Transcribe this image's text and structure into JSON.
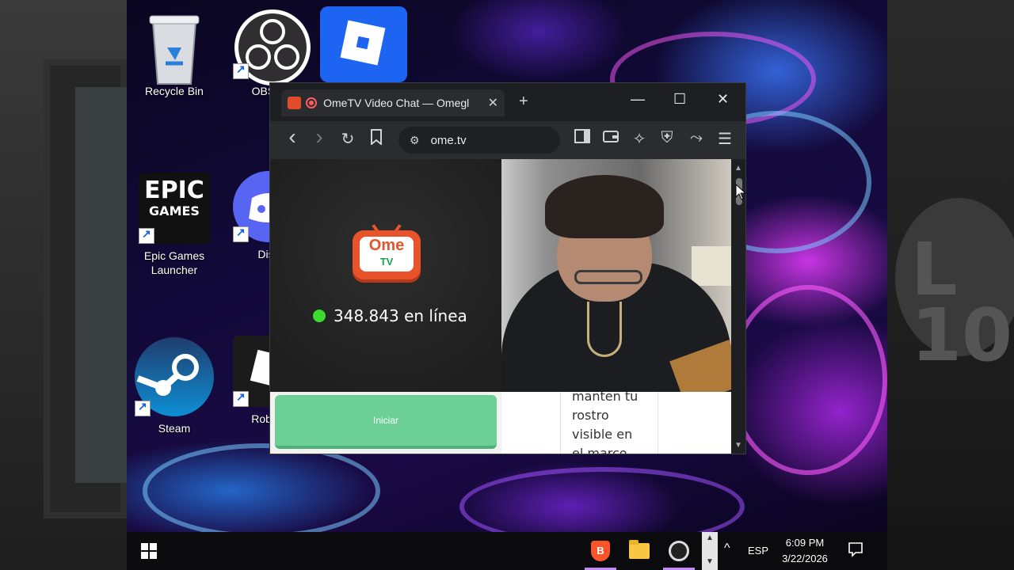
{
  "desktop": {
    "icons": [
      {
        "name": "recycle-bin",
        "label": "Recycle Bin"
      },
      {
        "name": "obs-studio",
        "label": "OBS S"
      },
      {
        "name": "roblox-studio",
        "label": ""
      },
      {
        "name": "epic-games",
        "label": "Epic Games\nLauncher",
        "badge": "EPIC\nGAMES"
      },
      {
        "name": "discord",
        "label": "Disc"
      },
      {
        "name": "steam",
        "label": "Steam"
      },
      {
        "name": "roblox",
        "label": "Roblox"
      }
    ],
    "watermark": "L\n10"
  },
  "browser": {
    "tab_title": "OmeTV Video Chat — Omegl",
    "tab_close": "✕",
    "new_tab": "+",
    "window_controls": {
      "minimize": "—",
      "maximize": "☐",
      "close": "✕"
    },
    "url": "ome.tv",
    "nav": {
      "back": "‹",
      "forward": "›",
      "reload": "↻",
      "bookmark": "🔖"
    }
  },
  "page": {
    "logo_top": "Ome",
    "logo_bottom": "TV",
    "online_text": "348.843 en línea",
    "start_button": "Iniciar",
    "info_text": "manten tu rostro visible en el marco"
  },
  "taskbar": {
    "lang": "ESP",
    "time": "6:09 PM",
    "date": "3/22/2026",
    "overflow": "^"
  },
  "colors": {
    "accent_green": "#6ccf96",
    "online_dot": "#3ddb2e",
    "ome_orange": "#e8532b",
    "taskbar_underline": "#c58af9"
  }
}
